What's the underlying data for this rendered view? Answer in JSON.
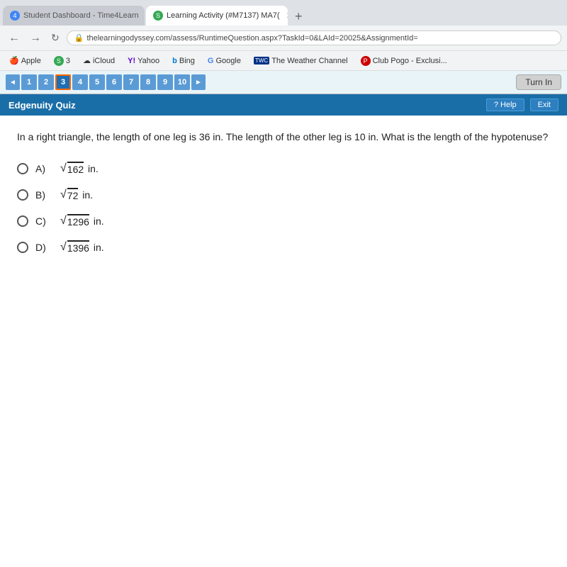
{
  "browser": {
    "tabs": [
      {
        "id": "tab1",
        "label": "Student Dashboard - Time4Learn",
        "icon_type": "blue",
        "icon_label": "4",
        "active": false
      },
      {
        "id": "tab2",
        "label": "Learning Activity (#M7137) MA7(",
        "icon_type": "green",
        "icon_label": "S",
        "active": true
      }
    ],
    "new_tab_label": "+",
    "url": "thelearningodyssey.com/assess/RuntimeQuestion.aspx?TaskId=0&LAId=20025&AssignmentId=",
    "lock_icon": "🔒"
  },
  "bookmarks": [
    {
      "id": "apple",
      "label": "Apple",
      "icon": "🍎"
    },
    {
      "id": "b3",
      "label": "3",
      "icon": "S"
    },
    {
      "id": "icloud",
      "label": "iCloud",
      "icon": "☁"
    },
    {
      "id": "yahoo",
      "label": "Yahoo",
      "icon": "Y"
    },
    {
      "id": "bing",
      "label": "Bing",
      "icon": "b"
    },
    {
      "id": "google",
      "label": "Google",
      "icon": "G"
    },
    {
      "id": "weather",
      "label": "The Weather Channel",
      "icon": "W"
    },
    {
      "id": "pogo",
      "label": "Club Pogo - Exclusi...",
      "icon": "P"
    }
  ],
  "question_nav": {
    "prev_arrow": "◄",
    "next_arrow": "►",
    "numbers": [
      "1",
      "2",
      "3",
      "4",
      "5",
      "6",
      "7",
      "8",
      "9",
      "10"
    ],
    "active_num": "3",
    "turn_in_label": "Turn In"
  },
  "quiz_header": {
    "title": "Edgenuity Quiz",
    "help_label": "? Help",
    "exit_label": "Exit"
  },
  "question": {
    "text": "In a right triangle, the length of one leg is 36 in. The length of the other leg is 10 in. What is the length of the hypotenuse?",
    "options": [
      {
        "id": "A",
        "label": "A)",
        "value": "162",
        "unit": "in."
      },
      {
        "id": "B",
        "label": "B)",
        "value": "72",
        "unit": "in."
      },
      {
        "id": "C",
        "label": "C)",
        "value": "1296",
        "unit": "in."
      },
      {
        "id": "D",
        "label": "D)",
        "value": "1396",
        "unit": "in."
      }
    ]
  }
}
